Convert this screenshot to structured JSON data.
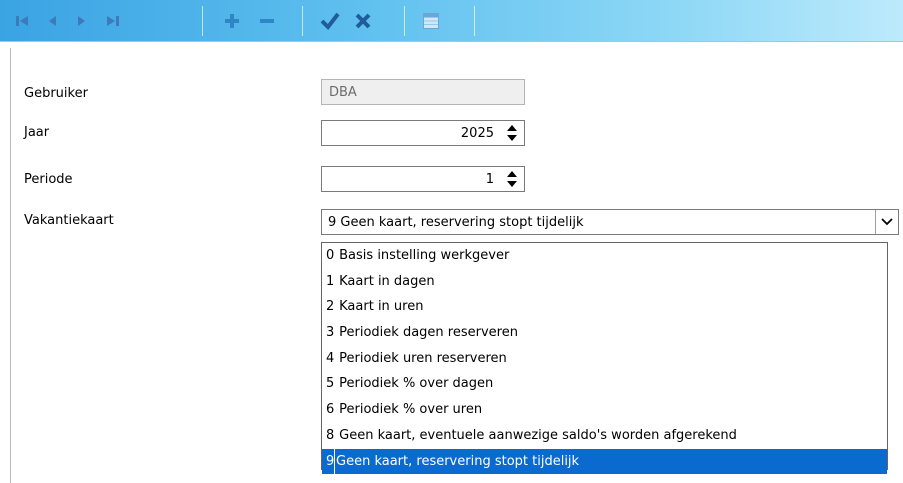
{
  "toolbar": {
    "buttons": [
      {
        "icon": "first-record-icon"
      },
      {
        "icon": "previous-record-icon"
      },
      {
        "icon": "next-record-icon"
      },
      {
        "icon": "last-record-icon"
      },
      {
        "icon": "add-icon"
      },
      {
        "icon": "remove-icon"
      },
      {
        "icon": "confirm-check-icon"
      },
      {
        "icon": "cancel-x-icon"
      },
      {
        "icon": "grid-view-icon"
      }
    ],
    "colors": {
      "gradient_start": "#3aa3e3",
      "gradient_end": "#bdeafc",
      "nav_icon": "#3d7ab8",
      "plus_minus": "#2f86c7",
      "check": "#1f5c99"
    }
  },
  "form": {
    "gebruiker": {
      "label": "Gebruiker",
      "value": "DBA"
    },
    "jaar": {
      "label": "Jaar",
      "value": "2025"
    },
    "periode": {
      "label": "Periode",
      "value": "1"
    },
    "vakantiekaart": {
      "label": "Vakantiekaart",
      "selected_code": "9",
      "selected_text": "Geen kaart, reservering stopt tijdelijk"
    }
  },
  "dropdown": {
    "options": [
      {
        "code": "0",
        "text": "Basis instelling werkgever"
      },
      {
        "code": "1",
        "text": "Kaart in dagen"
      },
      {
        "code": "2",
        "text": "Kaart in uren"
      },
      {
        "code": "3",
        "text": "Periodiek dagen reserveren"
      },
      {
        "code": "4",
        "text": "Periodiek uren reserveren"
      },
      {
        "code": "5",
        "text": "Periodiek % over dagen"
      },
      {
        "code": "6",
        "text": "Periodiek % over uren"
      },
      {
        "code": "8",
        "text": "Geen kaart, eventuele aanwezige saldo's worden afgerekend"
      },
      {
        "code": "9",
        "text": "Geen kaart, reservering stopt tijdelijk"
      }
    ],
    "highlighted_index": 8,
    "highlight_color": "#0a6ad0"
  }
}
